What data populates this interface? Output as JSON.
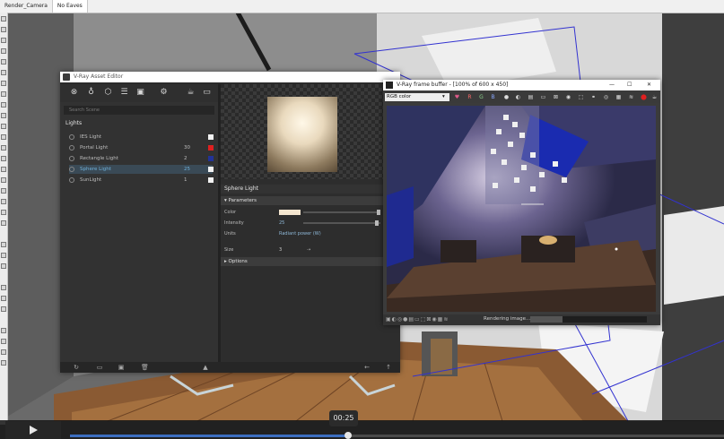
{
  "scene_tabs": [
    "Render_Camera",
    "No Eaves"
  ],
  "asset_editor": {
    "title": "V-Ray Asset Editor",
    "search_placeholder": "Search Scene",
    "category": "Lights",
    "lights": [
      {
        "name": "IES Light",
        "count": "",
        "swatch": "#f2f2f2",
        "selected": false
      },
      {
        "name": "Portal Light",
        "count": "30",
        "swatch": "#e02020",
        "selected": false
      },
      {
        "name": "Rectangle Light",
        "count": "2",
        "swatch": "#223399",
        "selected": false
      },
      {
        "name": "Sphere Light",
        "count": "25",
        "swatch": "#f2f2f2",
        "selected": true
      },
      {
        "name": "SunLight",
        "count": "1",
        "swatch": "#f2f2f2",
        "selected": false
      }
    ],
    "properties": {
      "title": "Sphere Light",
      "section_parameters": "Parameters",
      "color_label": "Color",
      "color_value": "#f4e6cf",
      "intensity_label": "Intensity",
      "intensity_value": "25",
      "units_label": "Units",
      "units_value": "Radiant power (W)",
      "size_label": "Size",
      "size_value": "3",
      "section_options": "Options"
    }
  },
  "frame_buffer": {
    "title": "V-Ray frame buffer - [100% of 600 x 450]",
    "channel": "RGB color",
    "status": "Rendering image...",
    "progress": 0.28
  },
  "video": {
    "time": "00:25",
    "progress": 0.425
  }
}
